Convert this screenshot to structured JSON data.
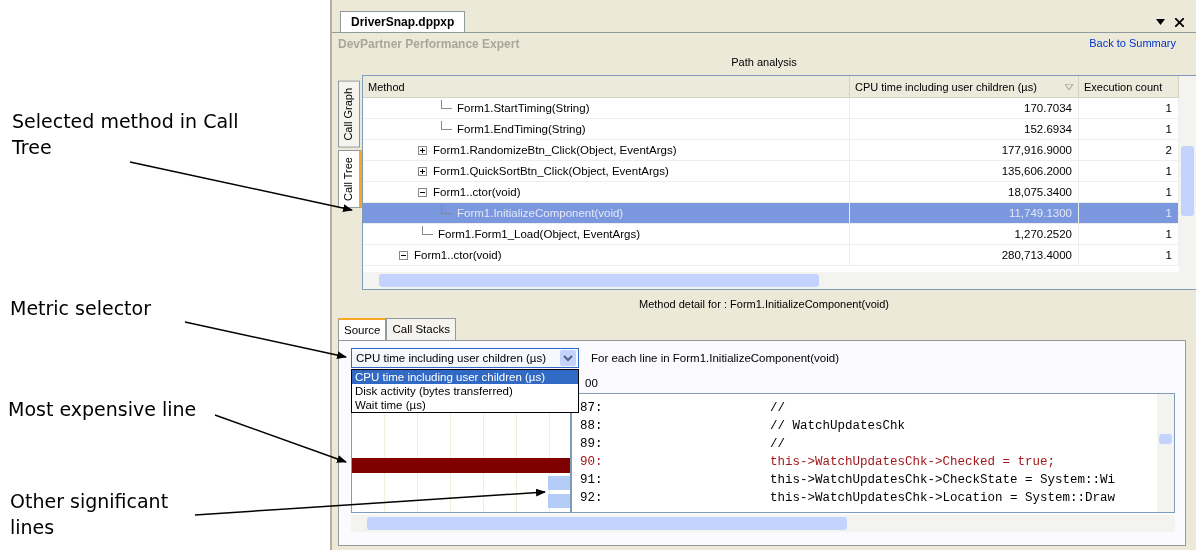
{
  "annotations": [
    {
      "text": "Selected method in Call Tree"
    },
    {
      "text": "Metric selector"
    },
    {
      "text": "Most expensive line"
    },
    {
      "text": "Other significant lines"
    }
  ],
  "document_tab": {
    "title": "DriverSnap.dppxp"
  },
  "header": {
    "product": "DevPartner Performance Expert",
    "link": "Back to Summary",
    "title": "Path analysis"
  },
  "side_tabs": [
    {
      "label": "Call Graph",
      "selected": false
    },
    {
      "label": "Call Tree",
      "selected": true
    }
  ],
  "tree": {
    "columns": [
      "Method",
      "CPU time including user children (µs)",
      "Execution count"
    ],
    "rows": [
      {
        "children": [
          {
            "children": [
              {
                "method": "Form1.StartTiming(String)",
                "cpu": "170.7034",
                "count": "1",
                "selected": false
              },
              {
                "method": "Form1.EndTiming(String)",
                "cpu": "152.6934",
                "count": "1",
                "selected": false
              }
            ]
          },
          {
            "method": "Form1.RandomizeBtn_Click(Object, EventArgs)",
            "cpu": "177,916.9000",
            "count": "2",
            "selected": false,
            "expanded": false
          },
          {
            "method": "Form1.QuickSortBtn_Click(Object, EventArgs)",
            "cpu": "135,606.2000",
            "count": "1",
            "selected": false,
            "expanded": false
          },
          {
            "method": "Form1..ctor(void)",
            "cpu": "18,075.3400",
            "count": "1",
            "selected": false,
            "expanded": true,
            "children": [
              {
                "method": "Form1.InitializeComponent(void)",
                "cpu": "11,749.1300",
                "count": "1",
                "selected": true
              }
            ]
          },
          {
            "method": "Form1.Form1_Load(Object, EventArgs)",
            "cpu": "1,270.2520",
            "count": "1",
            "selected": false
          }
        ]
      },
      {
        "method": "Form1..ctor(void)",
        "cpu": "280,713.4000",
        "count": "1",
        "selected": false,
        "expanded": true
      }
    ]
  },
  "detail": {
    "heading": "Method detail for : Form1.InitializeComponent(void)",
    "tabs": [
      {
        "label": "Source",
        "selected": true
      },
      {
        "label": "Call Stacks",
        "selected": false
      }
    ],
    "metric": {
      "value": "CPU time including user children (µs)",
      "expanded": true,
      "options": [
        {
          "label": "CPU time including user children (µs)",
          "selected": true
        },
        {
          "label": "Disk activity (bytes transferred)",
          "selected": false
        },
        {
          "label": "Wait time (µs)",
          "selected": false
        }
      ]
    },
    "caption": "For each line in Form1.InitializeComponent(void)",
    "column_header": "00",
    "lines": [
      {
        "number": "87:",
        "code": "//",
        "kind": "plain"
      },
      {
        "number": "88:",
        "code": "// WatchUpdatesChk",
        "kind": "plain"
      },
      {
        "number": "89:",
        "code": "//",
        "kind": "plain"
      },
      {
        "number": "90:",
        "code": "this->WatchUpdatesChk->Checked = true;",
        "kind": "hottest"
      },
      {
        "number": "91:",
        "code": "this->WatchUpdatesChk->CheckState = System::Wi",
        "kind": "significant"
      },
      {
        "number": "92:",
        "code": "this->WatchUpdatesChk->Location = System::Draw",
        "kind": "significant"
      }
    ]
  }
}
